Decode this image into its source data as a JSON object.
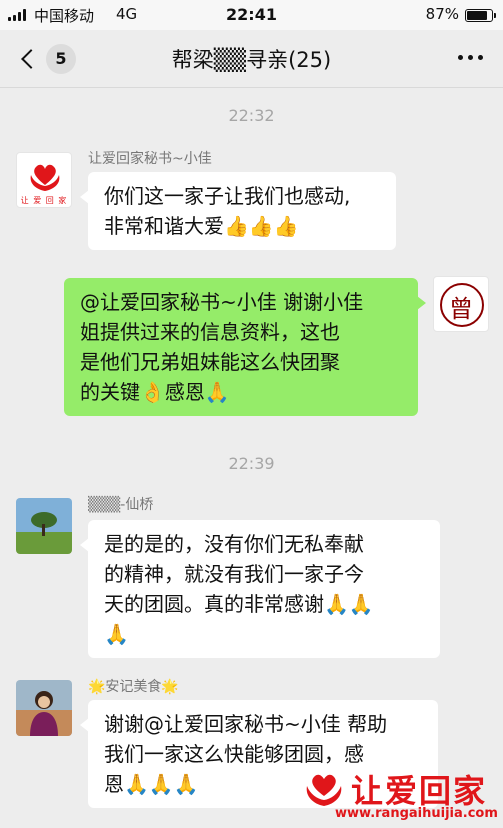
{
  "status_bar": {
    "carrier": "中国移动",
    "network": "4G",
    "time": "22:41",
    "battery_percent": "87%",
    "battery_level": 0.87
  },
  "nav": {
    "back_count": "5",
    "title": "帮梁▒▒寻亲(25)"
  },
  "timestamps": [
    "22:32",
    "22:39"
  ],
  "messages": [
    {
      "sender": "让爱回家秘书~小佳",
      "avatar_label": "让 爱 回 家",
      "lines": [
        "你们这一家子让我们也感动,",
        "非常和谐大爱👍👍👍"
      ]
    },
    {
      "sender": "",
      "avatar_label": "曾",
      "lines": [
        "@让爱回家秘书~小佳 谢谢小佳",
        "姐提供过来的信息资料，这也",
        "是他们兄弟姐妹能这么快团聚",
        "的关键👌感恩🙏"
      ]
    },
    {
      "sender": "▒▒▒-仙桥",
      "lines": [
        "是的是的，没有你们无私奉献",
        "的精神，就没有我们一家子今",
        "天的团圆。真的非常感谢🙏🙏",
        "🙏"
      ]
    },
    {
      "sender": "🌟安记美食🌟",
      "lines": [
        "谢谢@让爱回家秘书~小佳 帮助",
        "我们一家这么快能够团圆，感",
        "恩🙏🙏🙏"
      ]
    }
  ],
  "watermark": {
    "brand": "让爱回家",
    "url": "www.rangaihuijia.com"
  },
  "colors": {
    "background": "#ededed",
    "bubble_self": "#95ec69",
    "bubble_other": "#ffffff",
    "watermark_red": "#e0161a"
  }
}
